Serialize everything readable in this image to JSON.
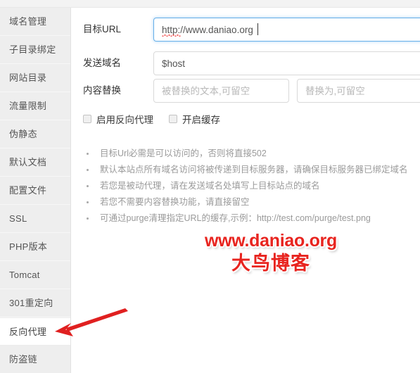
{
  "sidebar": {
    "items": [
      {
        "label": "域名管理",
        "active": false
      },
      {
        "label": "子目录绑定",
        "active": false
      },
      {
        "label": "网站目录",
        "active": false
      },
      {
        "label": "流量限制",
        "active": false
      },
      {
        "label": "伪静态",
        "active": false
      },
      {
        "label": "默认文档",
        "active": false
      },
      {
        "label": "配置文件",
        "active": false
      },
      {
        "label": "SSL",
        "active": false
      },
      {
        "label": "PHP版本",
        "active": false
      },
      {
        "label": "Tomcat",
        "active": false
      },
      {
        "label": "301重定向",
        "active": false
      },
      {
        "label": "反向代理",
        "active": true
      },
      {
        "label": "防盗链",
        "active": false
      }
    ]
  },
  "form": {
    "target_url": {
      "label": "目标URL",
      "value": "http://www.daniao.org",
      "placeholder": ""
    },
    "send_domain": {
      "label": "发送域名",
      "value": "$host",
      "placeholder": ""
    },
    "content_replace": {
      "label": "内容替换",
      "from_value": "",
      "from_placeholder": "被替换的文本,可留空",
      "to_value": "",
      "to_placeholder": "替换为,可留空"
    }
  },
  "checkboxes": [
    {
      "label": "启用反向代理",
      "checked": false
    },
    {
      "label": "开启缓存",
      "checked": false
    }
  ],
  "notes": [
    "目标Url必需是可以访问的，否则将直接502",
    "默认本站点所有域名访问将被传递到目标服务器，请确保目标服务器已绑定域名",
    "若您是被动代理，请在发送域名处填写上目标站点的域名",
    "若您不需要内容替换功能，请直接留空",
    "可通过purge清理指定URL的缓存,示例：http://test.com/purge/test.png"
  ],
  "watermark": {
    "line1": "www.daniao.org",
    "line2": "大鸟博客",
    "color": "#e8241f"
  },
  "annotation": {
    "arrow_color": "#e02020",
    "points_to": "反向代理"
  },
  "colors": {
    "sidebar_bg": "#eeeeee",
    "active_bg": "#ffffff",
    "focus_border": "#66afe9",
    "note_text": "#9a9a9a"
  }
}
